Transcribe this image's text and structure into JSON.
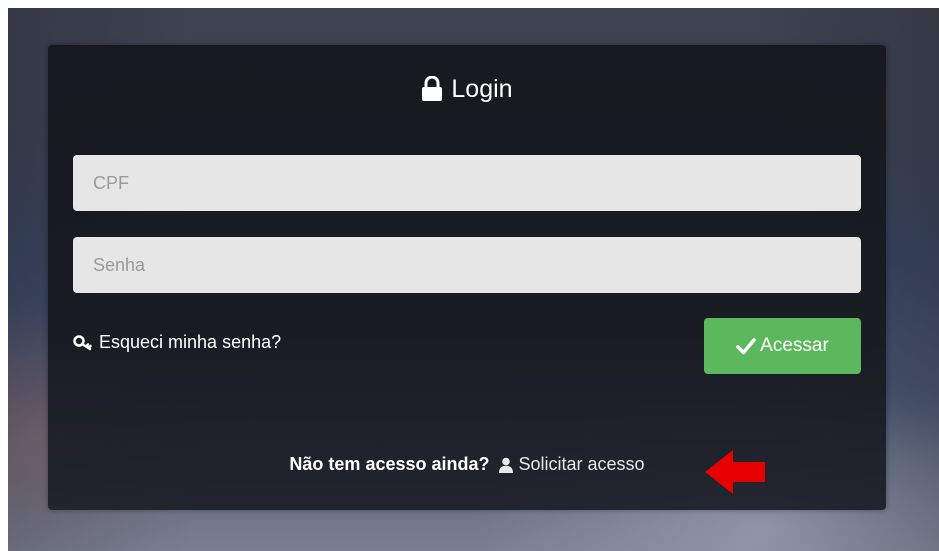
{
  "login": {
    "title": "Login",
    "cpf_placeholder": "CPF",
    "senha_placeholder": "Senha",
    "forgot_label": "Esqueci minha senha?",
    "submit_label": "Acessar",
    "no_access_text": "Não tem acesso ainda?",
    "request_access_label": "Solicitar acesso"
  },
  "icons": {
    "title": "lock-icon",
    "forgot": "key-icon",
    "submit": "check-icon",
    "request": "user-icon",
    "annotation": "arrow-left-icon"
  },
  "colors": {
    "panel_bg": "#181a20",
    "input_bg": "#e6e6e6",
    "submit_bg": "#5cb85c",
    "annotation_arrow": "#e60000",
    "text": "#ffffff"
  }
}
